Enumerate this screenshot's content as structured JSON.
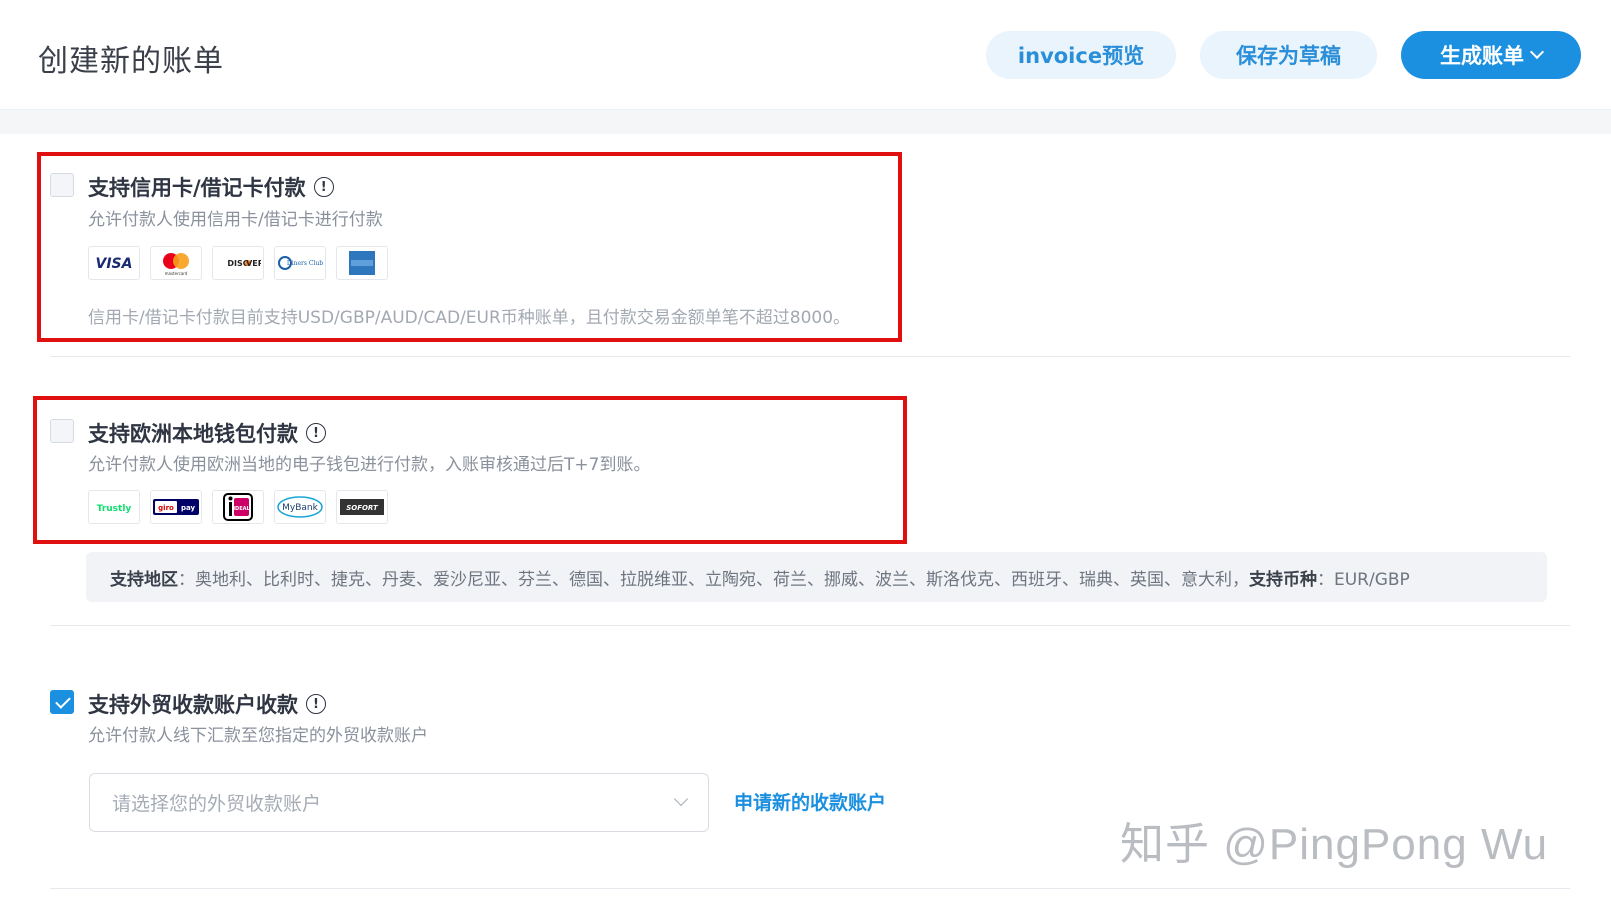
{
  "header": {
    "title": "创建新的账单",
    "preview_label": "invoice预览",
    "draft_label": "保存为草稿",
    "generate_label": "生成账单"
  },
  "card_section": {
    "checked": false,
    "title": "支持信用卡/借记卡付款",
    "info_glyph": "!",
    "description": "允许付款人使用信用卡/借记卡进行付款",
    "logos": [
      {
        "name": "visa",
        "label": "VISA"
      },
      {
        "name": "mastercard",
        "label": "mastercard"
      },
      {
        "name": "discover",
        "label": "DISCOVER"
      },
      {
        "name": "diners-club",
        "label": "Diners Club"
      },
      {
        "name": "american-express",
        "label": "AMERICAN EXPRESS"
      }
    ],
    "note": "信用卡/借记卡付款目前支持USD/GBP/AUD/CAD/EUR币种账单，且付款交易金额单笔不超过8000。"
  },
  "wallet_section": {
    "checked": false,
    "title": "支持欧洲本地钱包付款",
    "info_glyph": "!",
    "description": "允许付款人使用欧洲当地的电子钱包进行付款，入账审核通过后T+7到账。",
    "logos": [
      {
        "name": "trustly",
        "label": "Trustly"
      },
      {
        "name": "giropay",
        "label": "giropay"
      },
      {
        "name": "ideal",
        "label": "iDEAL"
      },
      {
        "name": "mybank",
        "label": "MyBank"
      },
      {
        "name": "sofort",
        "label": "SOFORT"
      }
    ],
    "region_label": "支持地区",
    "regions": "：奥地利、比利时、捷克、丹麦、爱沙尼亚、芬兰、德国、拉脱维亚、立陶宛、荷兰、挪威、波兰、斯洛伐克、西班牙、瑞典、英国、意大利，",
    "currency_label": "支持币种",
    "currencies": "：EUR/GBP"
  },
  "account_section": {
    "checked": true,
    "title": "支持外贸收款账户收款",
    "info_glyph": "!",
    "description": "允许付款人线下汇款至您指定的外贸收款账户",
    "select_placeholder": "请选择您的外贸收款账户",
    "apply_link": "申请新的收款账户"
  },
  "watermark": "知乎 @PingPong Wu",
  "colors": {
    "accent": "#1b8fe0",
    "light_button": "#e9f4fc",
    "highlight_box": "#e01010"
  }
}
